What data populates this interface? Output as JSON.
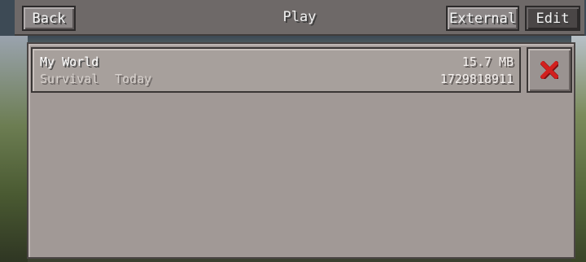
{
  "header": {
    "title": "Play",
    "back_label": "Back",
    "external_label": "External",
    "edit_label": "Edit"
  },
  "worlds": [
    {
      "name": "My World",
      "mode": "Survival",
      "date": "Today",
      "size": "15.7 MB",
      "seed": "1729818911",
      "delete_icon": "close-x-icon"
    }
  ],
  "colors": {
    "delete_icon": "#d2201e",
    "panel": "#a19996",
    "header": "#6e6968"
  }
}
